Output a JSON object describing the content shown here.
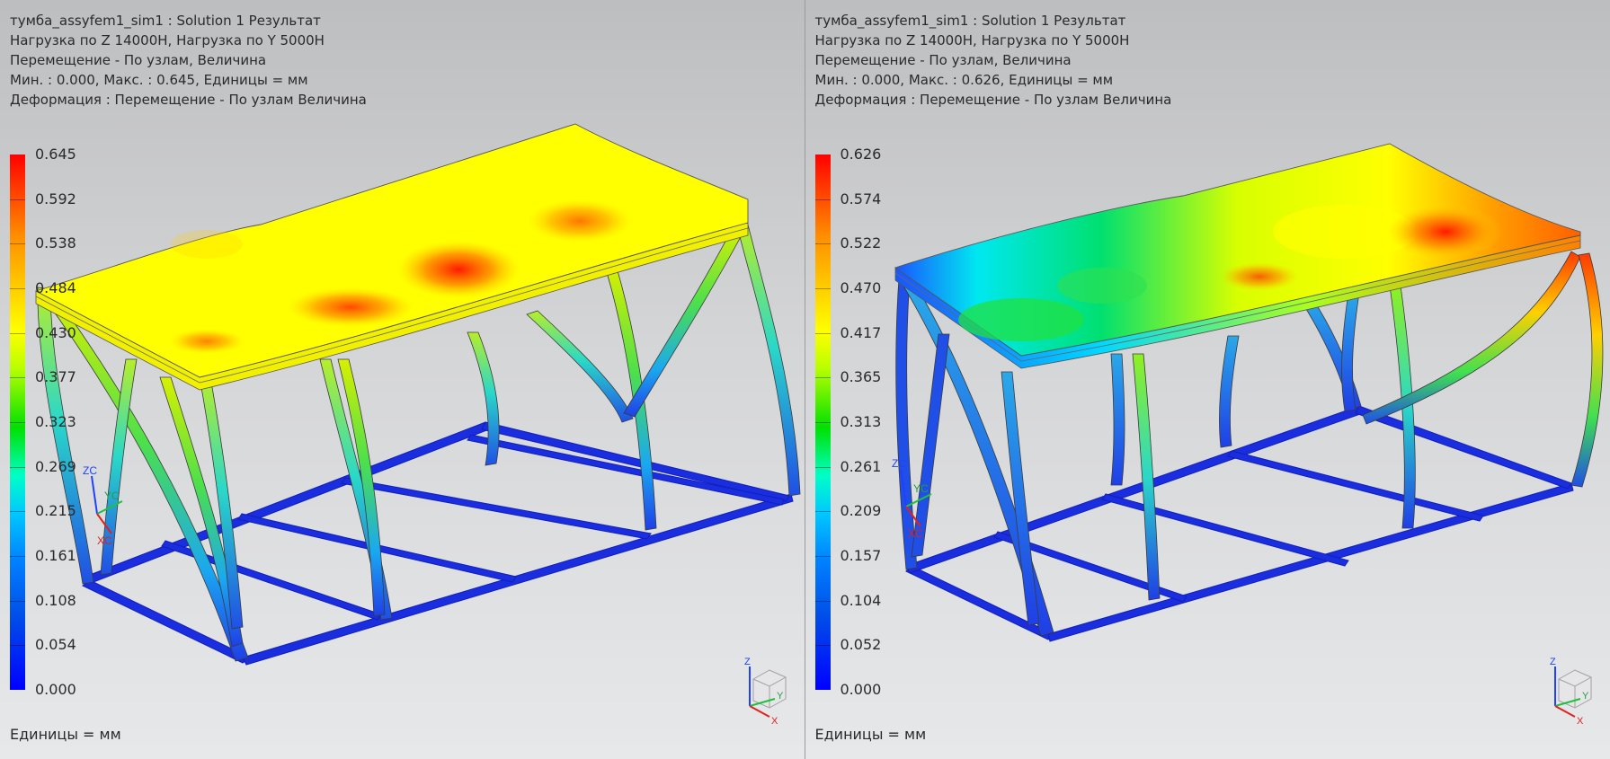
{
  "left": {
    "info": [
      "тумба_assyfem1_sim1 : Solution 1 Результат",
      "Нагрузка по Z 14000Н, Нагрузка по Y 5000Н",
      "Перемещение - По узлам, Величина",
      "Мин. : 0.000, Макс. : 0.645, Единицы = мм",
      "Деформация : Перемещение - По узлам Величина"
    ],
    "legend": [
      "0.645",
      "0.592",
      "0.538",
      "0.484",
      "0.430",
      "0.377",
      "0.323",
      "0.269",
      "0.215",
      "0.161",
      "0.108",
      "0.054",
      "0.000"
    ],
    "units": "Единицы = мм",
    "csys": {
      "zc": "ZC",
      "yc": "YC",
      "xc": "XC"
    }
  },
  "right": {
    "info": [
      "тумба_assyfem1_sim1 : Solution 1 Результат",
      "Нагрузка по Z 14000Н, Нагрузка по Y 5000Н",
      "Перемещение - По узлам, Величина",
      "Мин. : 0.000, Макс. : 0.626, Единицы = мм",
      "Деформация : Перемещение - По узлам Величина"
    ],
    "legend": [
      "0.626",
      "0.574",
      "0.522",
      "0.470",
      "0.417",
      "0.365",
      "0.313",
      "0.261",
      "0.209",
      "0.157",
      "0.104",
      "0.052",
      "0.000"
    ],
    "units": "Единицы = мм",
    "csys": {
      "zc": "ZC",
      "yc": "YC",
      "xc": "XC"
    }
  },
  "triad": {
    "z": "Z",
    "y": "Y",
    "x": "X"
  },
  "colors": {
    "max": "#ff0000",
    "min": "#0000ff",
    "frame": "#1a2fd8",
    "top": "#ffff00"
  }
}
